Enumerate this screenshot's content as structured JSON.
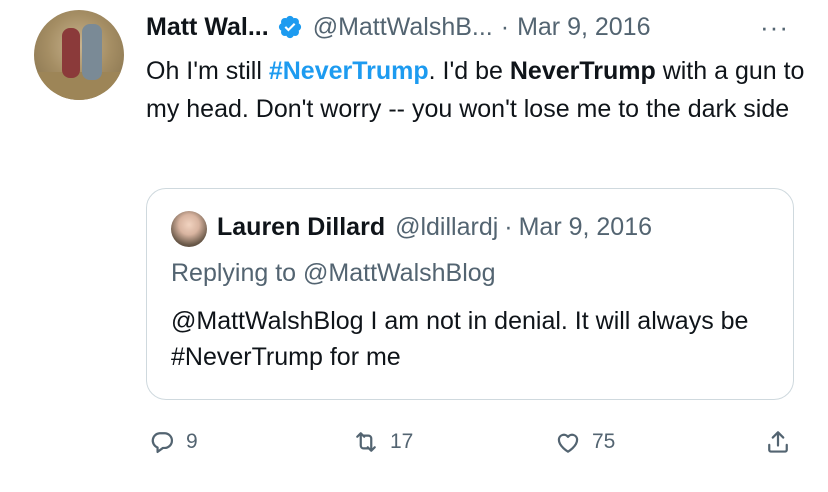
{
  "author": {
    "name": "Matt Wal...",
    "handle": "@MattWalshB...",
    "separator": "·",
    "date": "Mar 9, 2016",
    "more_label": "···"
  },
  "tweet": {
    "part1": "Oh I'm still ",
    "hashtag": "#NeverTrump",
    "part2": ". I'd be ",
    "bold": "NeverTrump",
    "part3": " with a gun to my head. Don't worry -- you won't lose me to the dark side"
  },
  "quote": {
    "name": "Lauren Dillard",
    "handle": "@ldillardj",
    "separator": "·",
    "date": "Mar 9, 2016",
    "replying_to": "Replying to @MattWalshBlog",
    "text": "@MattWalshBlog I am not in denial.  It will always be #NeverTrump for me"
  },
  "actions": {
    "replies": "9",
    "retweets": "17",
    "likes": "75"
  },
  "colors": {
    "hashtag": "#1d9bf0",
    "verified": "#1d9bf0",
    "muted": "#536471",
    "text": "#0f1419",
    "border": "#cfd9de"
  }
}
